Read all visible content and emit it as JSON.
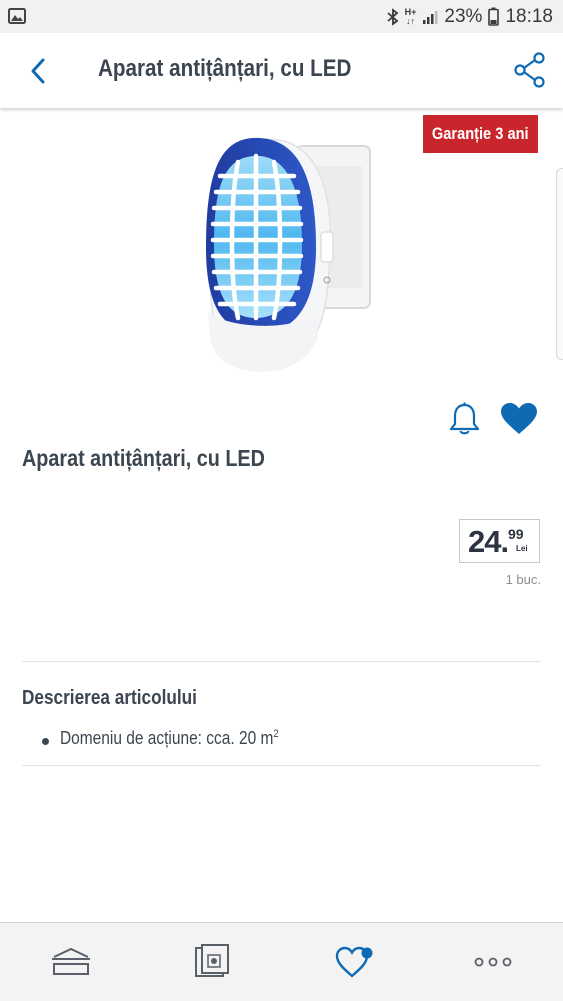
{
  "status_bar": {
    "network_label": "H+",
    "network_sub": "↓↑",
    "battery": "23%",
    "time": "18:18"
  },
  "header": {
    "title": "Aparat antițânțari, cu LED"
  },
  "product": {
    "badge": "Garanție 3 ani",
    "name": "Aparat antițânțari, cu LED",
    "favorited": true,
    "price": {
      "main": "24.",
      "cents": "99",
      "currency": "Lei"
    },
    "unit": "1 buc."
  },
  "description": {
    "heading": "Descrierea articolului",
    "items": [
      {
        "text": "Domeniu de acțiune: cca. 20 m",
        "sup": "2"
      }
    ]
  },
  "colors": {
    "accent_blue": "#0f6ab4",
    "badge_red": "#c8252c",
    "text_dark": "#3c4650"
  },
  "bottom_nav": [
    "home-icon",
    "leaflet-icon",
    "favorites-icon",
    "more-icon"
  ]
}
